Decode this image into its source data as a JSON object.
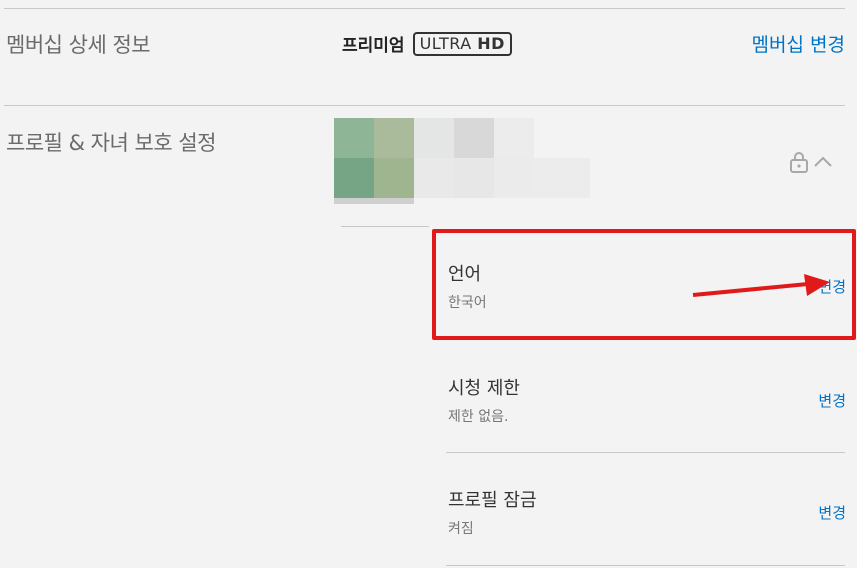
{
  "membership": {
    "title": "멤버십 상세 정보",
    "plan_name": "프리미엄",
    "plan_badge_ultra": "ULTRA",
    "plan_badge_hd": "HD",
    "change_link": "멤버십 변경"
  },
  "profile": {
    "title": "프로필 & 자녀 보호 설정",
    "lock_icon": "lock-icon",
    "collapse_icon": "chevron-up-icon"
  },
  "settings": [
    {
      "label": "언어",
      "value": "한국어",
      "action": "변경"
    },
    {
      "label": "시청 제한",
      "value": "제한 없음.",
      "action": "변경"
    },
    {
      "label": "프로필 잠금",
      "value": "켜짐",
      "action": "변경"
    }
  ],
  "colors": {
    "link": "#0073c5",
    "highlight": "#e01a1a",
    "background": "#f3f3f3"
  }
}
